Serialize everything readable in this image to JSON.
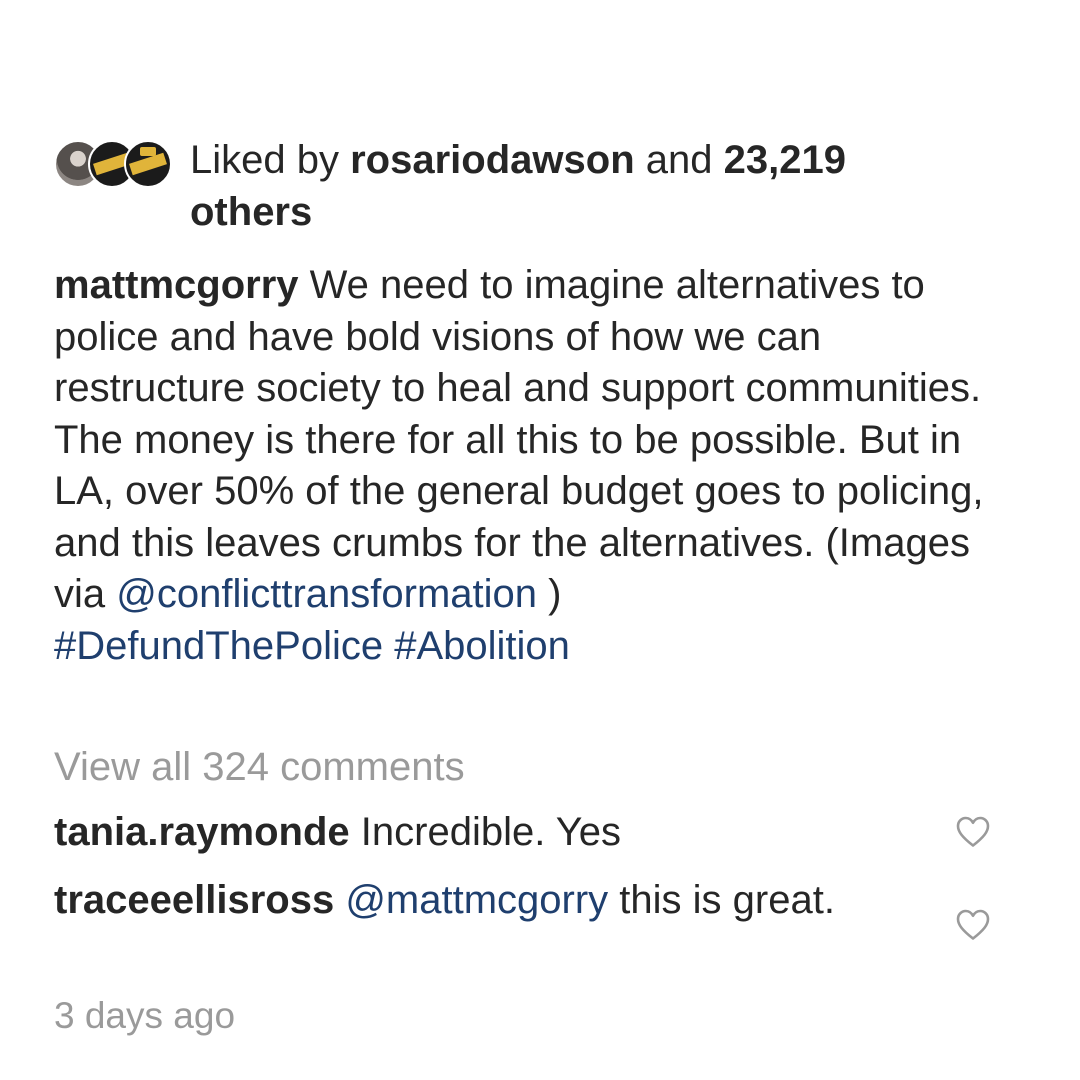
{
  "likes": {
    "prefix": "Liked by ",
    "user": "rosariodawson",
    "middle": " and ",
    "count": "23,219",
    "suffix": "others"
  },
  "caption": {
    "username": "mattmcgorry",
    "text_1": " We need to imagine alternatives to police and have bold visions of how we can restructure society to heal and support communities. The money is there for all this to be possible. But in LA, over 50% of the general budget goes to policing, and this leaves crumbs for the alternatives. (Images via ",
    "mention": "@conflicttransformation",
    "text_2": " )",
    "hashtag_1": "#DefundThePolice",
    "hashtag_2": "#Abolition"
  },
  "view_all": "View all 324 comments",
  "comments": [
    {
      "username": "tania.raymonde",
      "text": " Incredible. Yes"
    },
    {
      "username": "traceeellisross",
      "mention": "@mattmcgorry",
      "text": " this is great."
    }
  ],
  "timestamp": "3 days ago",
  "icons": {
    "like": "heart-outline-icon"
  },
  "colors": {
    "text": "#262626",
    "link": "#1f3f6e",
    "muted": "#9a9a9a"
  }
}
